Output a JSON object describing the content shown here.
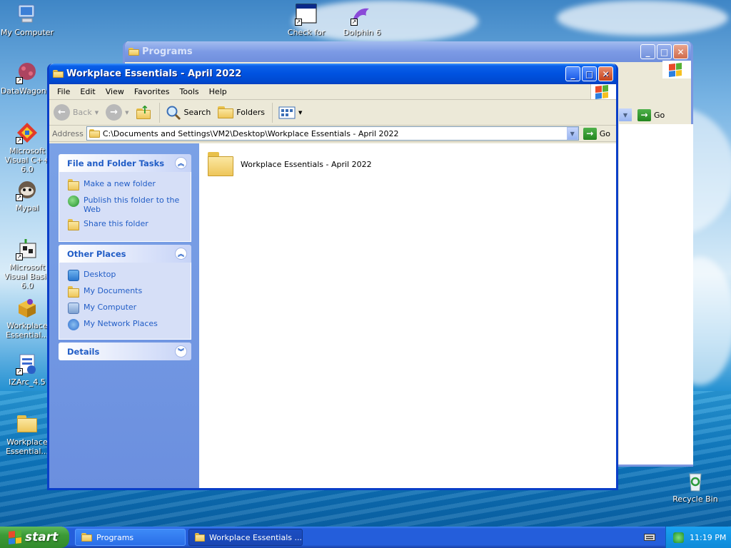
{
  "desktop": {
    "icons": [
      {
        "label": "My Computer",
        "icon": "computer-icon"
      },
      {
        "label": "DataWagon...",
        "icon": "datawagon-icon"
      },
      {
        "label": "Microsoft Visual C++ 6.0",
        "icon": "visual-cpp-icon"
      },
      {
        "label": "Mypal",
        "icon": "mypal-icon"
      },
      {
        "label": "Microsoft Visual Basic 6.0",
        "icon": "visual-basic-icon"
      },
      {
        "label": "Workplace Essential...",
        "icon": "installer-box-icon"
      },
      {
        "label": "IZArc_4.5",
        "icon": "izarc-icon"
      },
      {
        "label": "Workplace Essential...",
        "icon": "folder-icon"
      },
      {
        "label": "Check for",
        "icon": "window-app-icon"
      },
      {
        "label": "Dolphin 6",
        "icon": "dolphin-icon"
      },
      {
        "label": "Recycle Bin",
        "icon": "recycle-bin-icon"
      }
    ]
  },
  "back_window": {
    "title": "Programs",
    "go_label": "Go"
  },
  "window": {
    "title": "Workplace Essentials - April 2022",
    "menu": [
      "File",
      "Edit",
      "View",
      "Favorites",
      "Tools",
      "Help"
    ],
    "toolbar": {
      "back": "Back",
      "search": "Search",
      "folders": "Folders"
    },
    "address": {
      "label": "Address",
      "path": "C:\\Documents and Settings\\VM2\\Desktop\\Workplace Essentials - April 2022",
      "go_label": "Go"
    },
    "tasks": {
      "file_folder": {
        "title": "File and Folder Tasks",
        "items": [
          "Make a new folder",
          "Publish this folder to the Web",
          "Share this folder"
        ]
      },
      "other_places": {
        "title": "Other Places",
        "items": [
          "Desktop",
          "My Documents",
          "My Computer",
          "My Network Places"
        ]
      },
      "details": {
        "title": "Details"
      }
    },
    "files": [
      {
        "name": "Workplace Essentials - April 2022",
        "icon": "folder-icon"
      }
    ]
  },
  "taskbar": {
    "start_label": "start",
    "tasks": [
      {
        "label": "Programs",
        "active": false
      },
      {
        "label": "Workplace Essentials ...",
        "active": true
      }
    ],
    "clock": "11:19 PM"
  },
  "colors": {
    "title_active": "#0052e0",
    "task_link": "#215dc6",
    "start_green": "#3c9a36"
  }
}
